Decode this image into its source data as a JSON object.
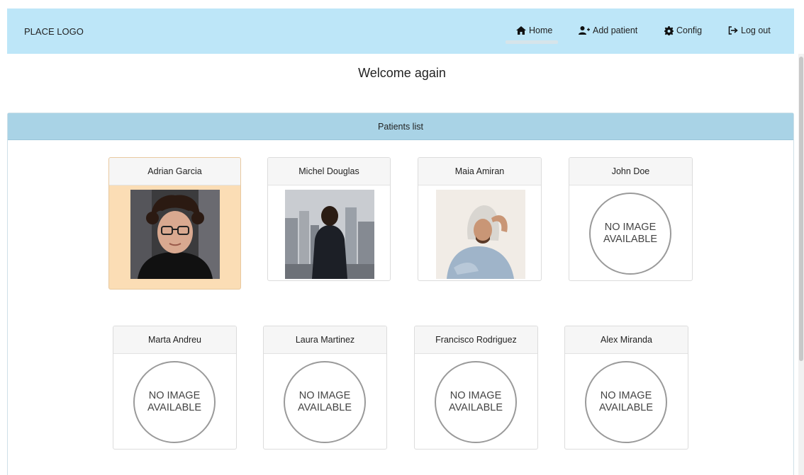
{
  "navbar": {
    "logo": "PLACE LOGO",
    "items": [
      {
        "label": "Home",
        "icon": "home-icon"
      },
      {
        "label": "Add patient",
        "icon": "user-plus-icon"
      },
      {
        "label": "Config",
        "icon": "gear-icon"
      },
      {
        "label": "Log out",
        "icon": "logout-icon"
      }
    ]
  },
  "welcome": "Welcome again",
  "panel": {
    "title": "Patients list"
  },
  "no_image_text": "NO IMAGE\nAVAILABLE",
  "patients": [
    {
      "name": "Adrian Garcia",
      "has_photo": true,
      "selected": true
    },
    {
      "name": "Michel Douglas",
      "has_photo": true,
      "selected": false
    },
    {
      "name": "Maia Amiran",
      "has_photo": true,
      "selected": false
    },
    {
      "name": "John Doe",
      "has_photo": false,
      "selected": false
    },
    {
      "name": "Marta Andreu",
      "has_photo": false,
      "selected": false
    },
    {
      "name": "Laura Martinez",
      "has_photo": false,
      "selected": false
    },
    {
      "name": "Francisco Rodriguez",
      "has_photo": false,
      "selected": false
    },
    {
      "name": "Alex Miranda",
      "has_photo": false,
      "selected": false
    }
  ],
  "colors": {
    "navbar_bg": "#bde6f8",
    "panel_header_bg": "#a9d3e6",
    "selected_card_bg": "#fbddb5"
  }
}
